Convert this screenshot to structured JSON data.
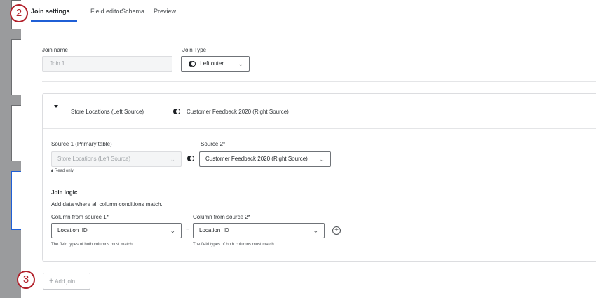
{
  "tabs": [
    {
      "label": "Join settings",
      "active": true
    },
    {
      "label": "Field editor",
      "active": false
    },
    {
      "label": "Schema",
      "active": false
    },
    {
      "label": "Preview",
      "active": false
    }
  ],
  "callouts": {
    "step_2": "2",
    "step_3": "3"
  },
  "join_name": {
    "label": "Join name",
    "value": "Join 1"
  },
  "join_type": {
    "label": "Join Type",
    "value": "Left outer",
    "icon": "left-outer-join-icon"
  },
  "join_panel": {
    "header_left": "Store Locations (Left Source)",
    "header_right": "Customer Feedback 2020 (Right Source)",
    "source1": {
      "label": "Source 1 (Primary table)",
      "value": "Store Locations (Left Source)",
      "note": "Read only"
    },
    "source2": {
      "label": "Source 2*",
      "value": "Customer Feedback 2020 (Right Source)"
    },
    "join_logic": {
      "title": "Join logic",
      "description": "Add data where all column conditions match.",
      "col1": {
        "label": "Column from source 1*",
        "value": "Location_ID",
        "hint": "The field types of both columns must match"
      },
      "equals": "=",
      "col2": {
        "label": "Column from source 2*",
        "value": "Location_ID",
        "hint": "The field types of both columns must match"
      }
    }
  },
  "add_join": {
    "label": "Add join"
  },
  "colors": {
    "accent": "#1f5fd6",
    "callout": "#b2202a"
  }
}
